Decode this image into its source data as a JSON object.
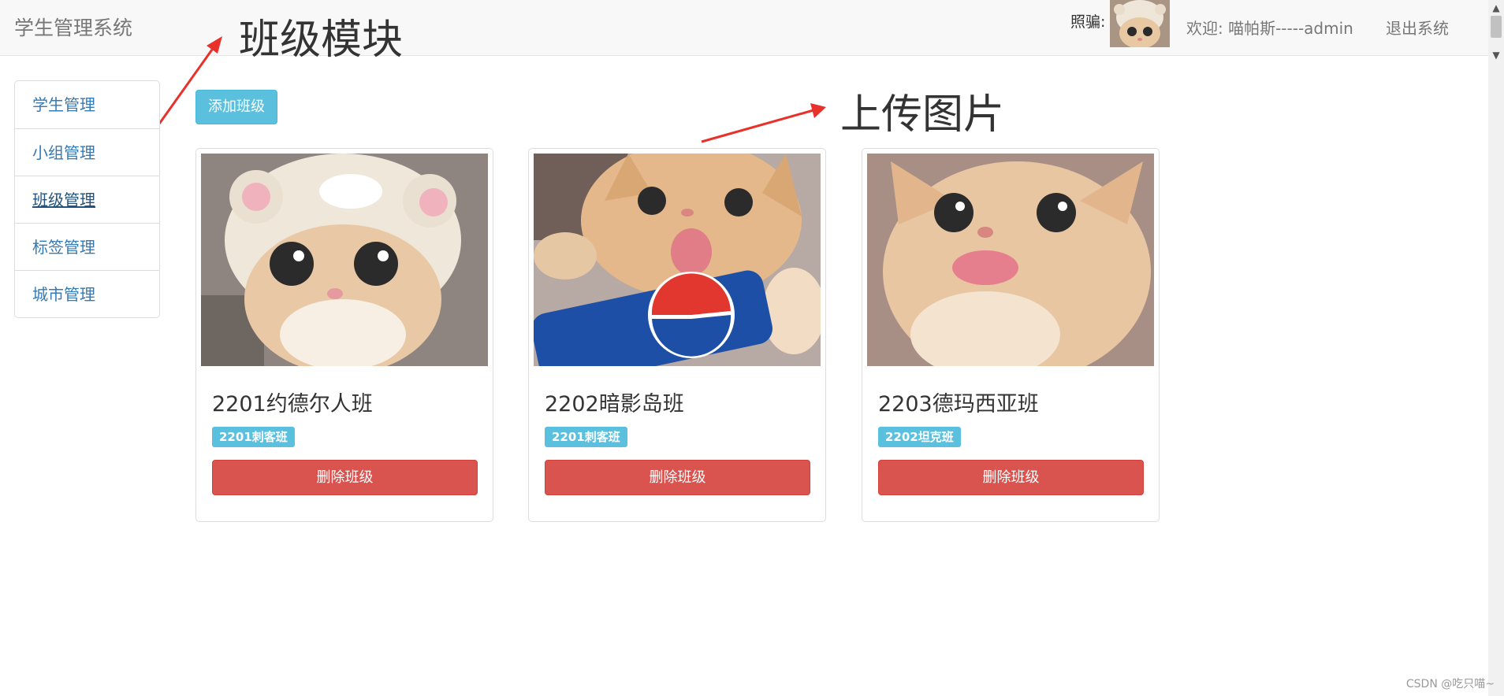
{
  "navbar": {
    "brand": "学生管理系统",
    "photo_label": "照骗:",
    "welcome": "欢迎: 喵帕斯-----admin",
    "logout": "退出系统"
  },
  "annotations": {
    "class_module": "班级模块",
    "upload_image": "上传图片",
    "arrow_color": "#e8312a"
  },
  "sidebar": {
    "items": [
      {
        "label": "学生管理"
      },
      {
        "label": "小组管理"
      },
      {
        "label": "班级管理"
      },
      {
        "label": "标签管理"
      },
      {
        "label": "城市管理"
      }
    ],
    "active_index": 2
  },
  "toolbar": {
    "add_label": "添加班级"
  },
  "cards": [
    {
      "title": "2201约德尔人班",
      "tag": "2201刺客班",
      "delete_label": "删除班级",
      "image": "cat-in-bear-hat"
    },
    {
      "title": "2202暗影岛班",
      "tag": "2201刺客班",
      "delete_label": "删除班级",
      "image": "cat-with-pepsi-can"
    },
    {
      "title": "2203德玛西亚班",
      "tag": "2202坦克班",
      "delete_label": "删除班级",
      "image": "cat-tongue-out"
    }
  ],
  "watermark": "CSDN @吃只喵~",
  "colors": {
    "info": "#5bc0de",
    "danger": "#d9534f",
    "link": "#337ab7",
    "navbar_bg": "#f8f8f8"
  }
}
